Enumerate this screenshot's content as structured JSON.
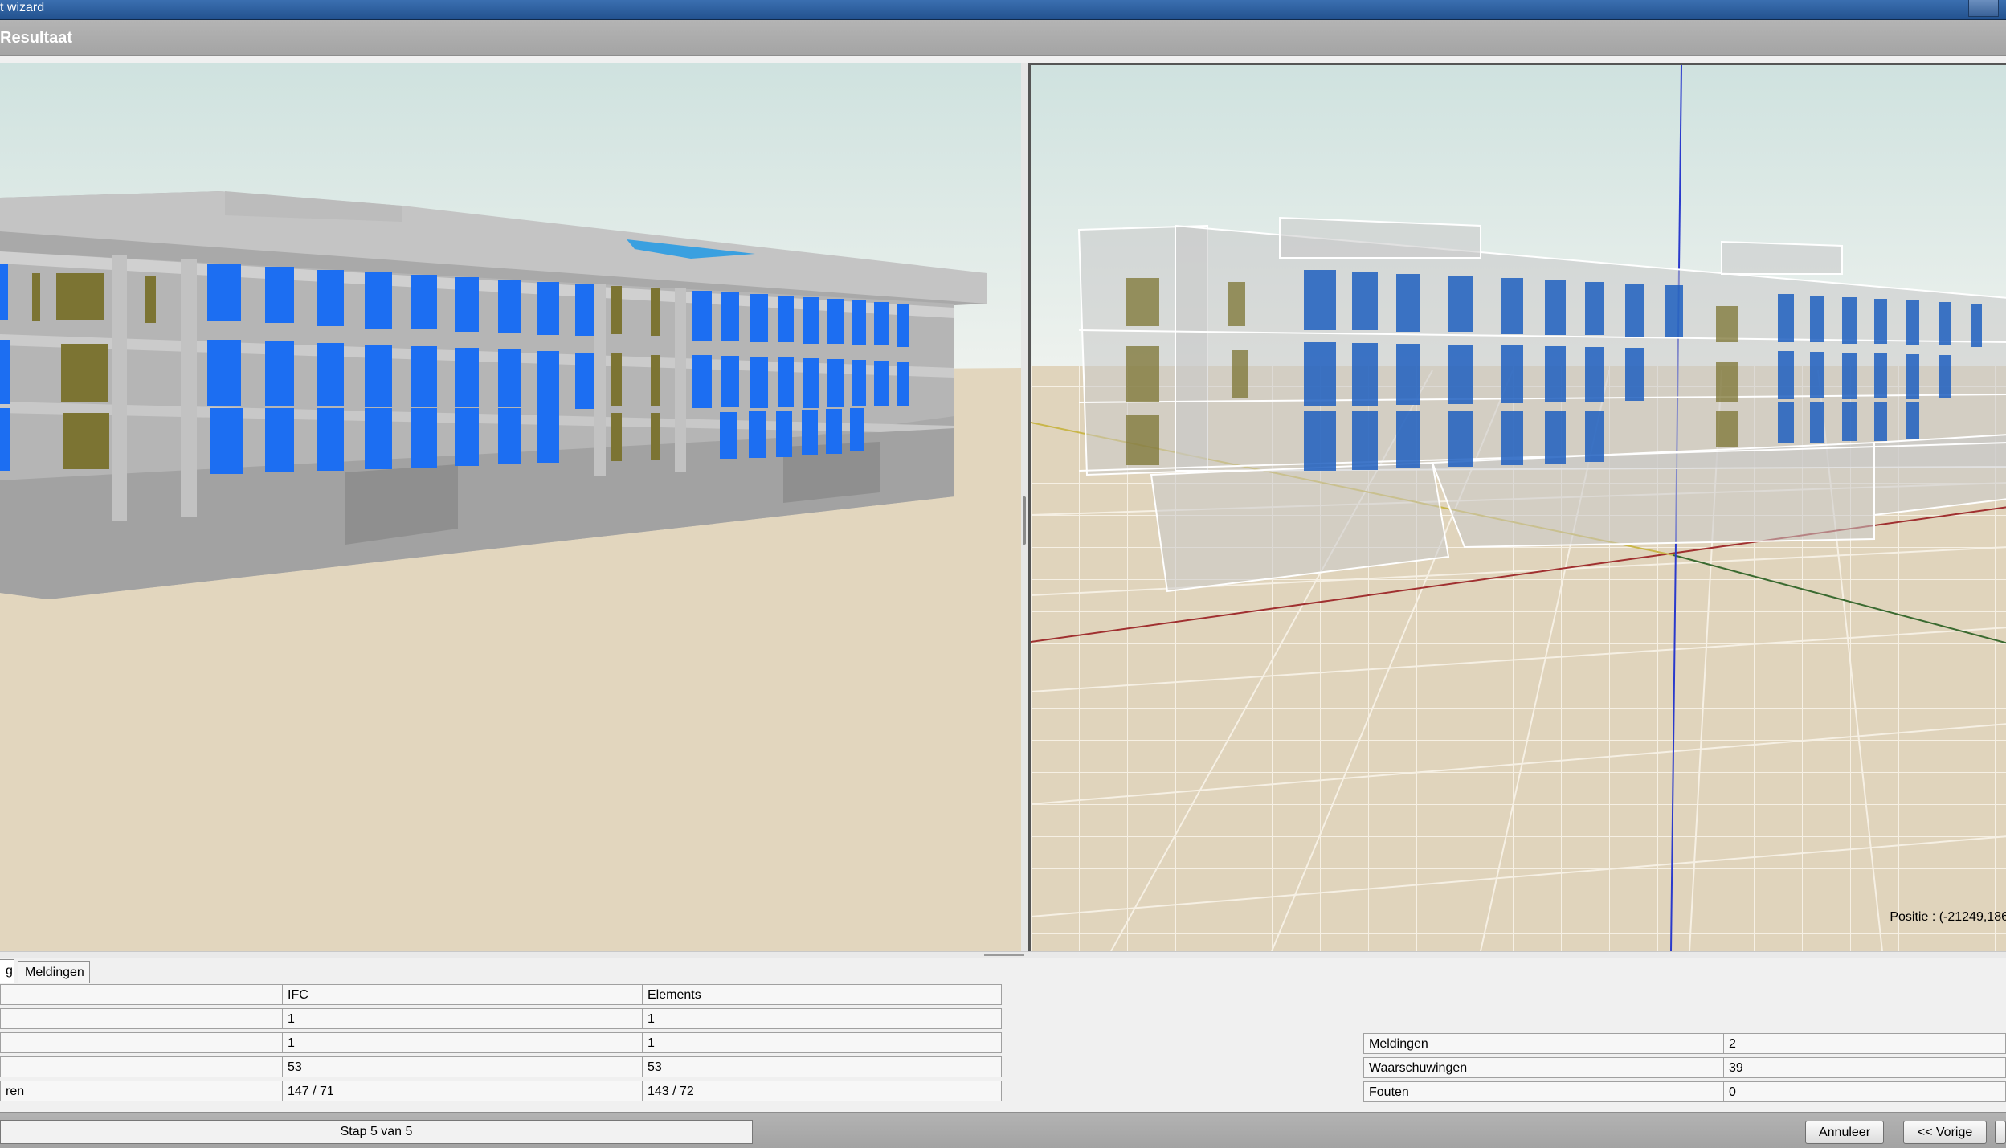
{
  "window": {
    "title": "t wizard"
  },
  "header": {
    "title": "Resultaat"
  },
  "viewer": {
    "position_readout": "Positie : (-21249,186"
  },
  "tabs": [
    {
      "label": "g"
    },
    {
      "label": "Meldingen"
    }
  ],
  "comparison_table": {
    "columns": [
      "",
      "IFC",
      "Elements"
    ],
    "rows": [
      [
        "",
        "1",
        "1"
      ],
      [
        "",
        "1",
        "1"
      ],
      [
        "",
        "53",
        "53"
      ],
      [
        "ren",
        "147 / 71",
        "143 / 72"
      ]
    ]
  },
  "messages_table": {
    "rows": [
      [
        "Meldingen",
        "2"
      ],
      [
        "Waarschuwingen",
        "39"
      ],
      [
        "Fouten",
        "0"
      ]
    ]
  },
  "footer": {
    "step": "Stap 5 van 5",
    "cancel_label": "Annuleer",
    "back_label": "<< Vorige"
  }
}
